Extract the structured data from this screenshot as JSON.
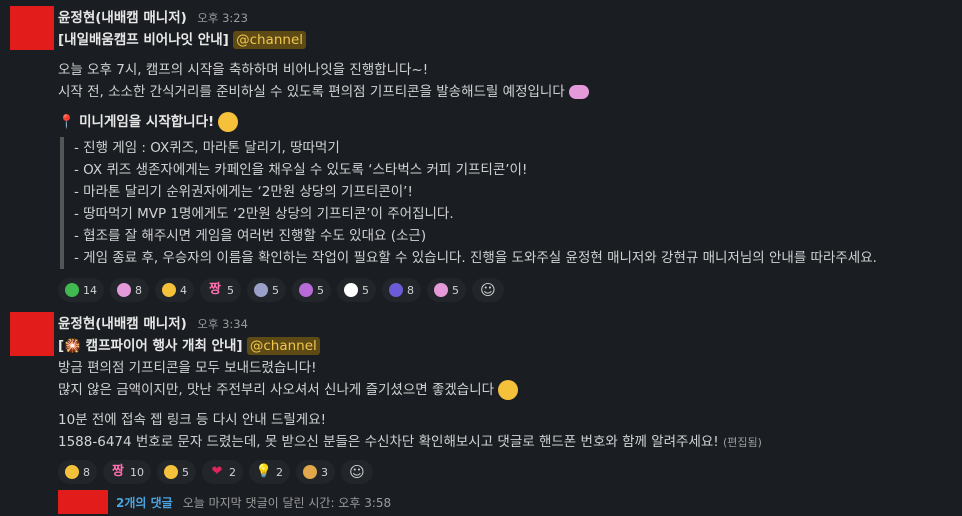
{
  "message1": {
    "author": "윤정현(내배캠 매니저)",
    "time": "오후 3:23",
    "title_prefix": "[내일배움캠프 비어나잇 안내]",
    "mention": "@channel",
    "body": [
      "오늘 오후 7시, 캠프의 시작을 축하하며 비어나잇을 진행합니다~!",
      "시작 전, 소소한 간식거리를 준비하실 수 있도록 편의점 기프티콘을 발송해드릴 예정입니다"
    ],
    "section_title": "미니게임을 시작합니다!",
    "quote_lines": [
      "- 진행 게임 : OX퀴즈, 마라톤 달리기, 땅따먹기",
      "- OX 퀴즈 생존자에게는 카페인을 채우실 수 있도록 ‘스타벅스 커피 기프티콘’이!",
      "- 마라톤 달리기 순위권자에게는 ‘2만원 상당의 기프티콘이’!",
      "- 땅따먹기 MVP 1명에게도 ‘2만원 상당의 기프티콘’이 주어집니다.",
      "- 협조를 잘 해주시면 게임을 여러번 진행할 수도 있대요 (소근)",
      "- 게임 종료 후, 우승자의 이름을 확인하는 작업이 필요할 수 있습니다. 진행을 도와주실 윤정현 매니저와 강현규 매니저님의 안내를 따라주세요."
    ],
    "reactions": [
      {
        "icon": "green-blob-emoji",
        "count": "14",
        "color": "#3fb950"
      },
      {
        "icon": "pig-emoji",
        "count": "8",
        "color": "#e49ad8"
      },
      {
        "icon": "thumbs-up-emoji",
        "count": "4",
        "color": "#f5c13b"
      },
      {
        "icon": "jjang-emoji",
        "glyph": "짱",
        "count": "5",
        "color": "#ff6fae"
      },
      {
        "icon": "gray-blob-emoji",
        "count": "5",
        "color": "#9aa0c8"
      },
      {
        "icon": "purple-blob-emoji",
        "count": "5",
        "color": "#b86bd6"
      },
      {
        "icon": "cow-emoji",
        "count": "5",
        "color": "#ffffff"
      },
      {
        "icon": "sparkle-emoji",
        "count": "8",
        "color": "#6b5bd6"
      },
      {
        "icon": "pig-emoji",
        "count": "5",
        "color": "#e49ad8"
      }
    ]
  },
  "message2": {
    "author": "윤정현(내배캠 매니저)",
    "time": "오후 3:34",
    "title_prefix": "[🎇 캠프파이어 행사 개최 안내]",
    "mention": "@channel",
    "body": [
      "방금 편의점 기프티콘을 모두 보내드렸습니다!",
      "많지 않은 금액이지만, 맛난 주전부리 사오셔서 신나게 즐기셨으면 좋겠습니다"
    ],
    "body2": [
      "10분 전에 접속 젭 링크 등 다시 안내 드릴게요!",
      "1588-6474 번호로 문자 드렸는데, 못 받으신 분들은 수신차단 확인해보시고 댓글로 핸드폰 번호와 함께 알려주세요!"
    ],
    "edited": "(편집됨)",
    "reactions": [
      {
        "icon": "thumbs-up-emoji",
        "count": "8",
        "color": "#f5c13b"
      },
      {
        "icon": "jjang-emoji",
        "glyph": "짱",
        "count": "10",
        "color": "#ff6fae"
      },
      {
        "icon": "cheese-emoji",
        "count": "5",
        "color": "#f5c13b"
      },
      {
        "icon": "heart-emoji",
        "glyph": "❤",
        "count": "2",
        "color": "#e0245e"
      },
      {
        "icon": "bulb-emoji",
        "glyph": "💡",
        "count": "2",
        "color": "#f5c13b"
      },
      {
        "icon": "clap-emoji",
        "count": "3",
        "color": "#e0a84a"
      }
    ]
  },
  "thread": {
    "count": "2개의 댓글",
    "last": "오늘 마지막 댓글이 달린 시간: 오후 3:58"
  }
}
